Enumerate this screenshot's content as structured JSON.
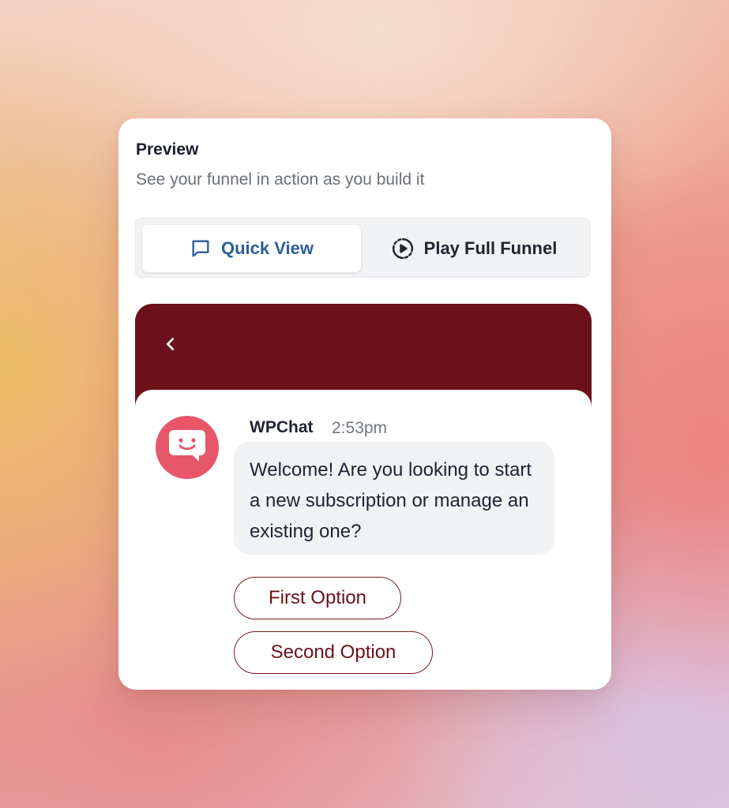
{
  "preview": {
    "title": "Preview",
    "subtitle": "See your funnel in action as you build it"
  },
  "tabs": [
    {
      "label": "Quick View",
      "icon": "chat-bubble-icon",
      "active": true
    },
    {
      "label": "Play Full Funnel",
      "icon": "play-circle-icon",
      "active": false
    }
  ],
  "chat": {
    "header_color": "#6c1119",
    "back_icon": "chevron-left-icon",
    "avatar_icon": "smile-chat-icon",
    "avatar_color": "#e8566a",
    "sender": "WPChat",
    "time": "2:53pm",
    "message": "Welcome! Are you looking to start a new subscription or manage an existing one?",
    "options": [
      "First Option",
      "Second Option"
    ]
  },
  "colors": {
    "accent_blue": "#2b5e9a",
    "brand_maroon": "#6c1119",
    "avatar_pink": "#e8566a"
  }
}
